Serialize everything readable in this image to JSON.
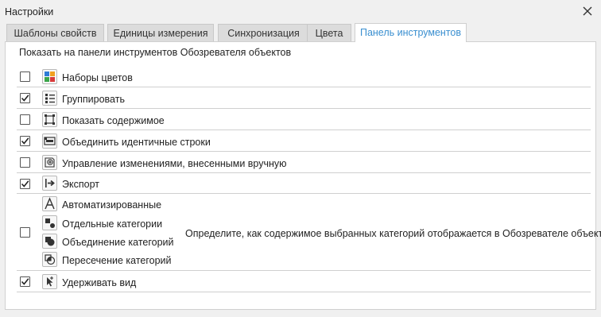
{
  "window": {
    "title": "Настройки"
  },
  "tabs": [
    {
      "label": "Шаблоны свойств",
      "active": false
    },
    {
      "label": "Единицы измерения",
      "active": false
    },
    {
      "label": "Синхронизация",
      "active": false
    },
    {
      "label": "Цвета",
      "active": false
    },
    {
      "label": "Панель инструментов",
      "active": true
    }
  ],
  "toolbar_settings": {
    "heading": "Показать на панели инструментов Обозревателя объектов",
    "items": [
      {
        "label": "Наборы цветов",
        "checked": false,
        "icon": "color-sets-icon"
      },
      {
        "label": "Группировать",
        "checked": true,
        "icon": "group-list-icon"
      },
      {
        "label": "Показать содержимое",
        "checked": false,
        "icon": "show-contents-icon"
      },
      {
        "label": "Объединить идентичные строки",
        "checked": true,
        "icon": "merge-rows-icon"
      },
      {
        "label": "Управление изменениями, внесенными вручную",
        "checked": false,
        "icon": "manual-changes-icon"
      },
      {
        "label": "Экспорт",
        "checked": true,
        "icon": "export-icon"
      }
    ],
    "category_group": {
      "checked": false,
      "options": [
        {
          "label": "Автоматизированные",
          "icon": "automatic-icon"
        },
        {
          "label": "Отдельные категории",
          "icon": "separate-categories-icon"
        },
        {
          "label": "Объединение категорий",
          "icon": "union-categories-icon"
        },
        {
          "label": "Пересечение категорий",
          "icon": "intersect-categories-icon"
        }
      ],
      "description": "Определите, как содержимое выбранных категорий отображается в Обозревателе объектов"
    },
    "keep_view": {
      "label": "Удерживать вид",
      "checked": true,
      "icon": "keep-view-icon"
    }
  },
  "colors": {
    "active_tab_text": "#3a8fd0",
    "tab_bg": "#dcdcdc",
    "panel_bg": "#ffffff"
  }
}
